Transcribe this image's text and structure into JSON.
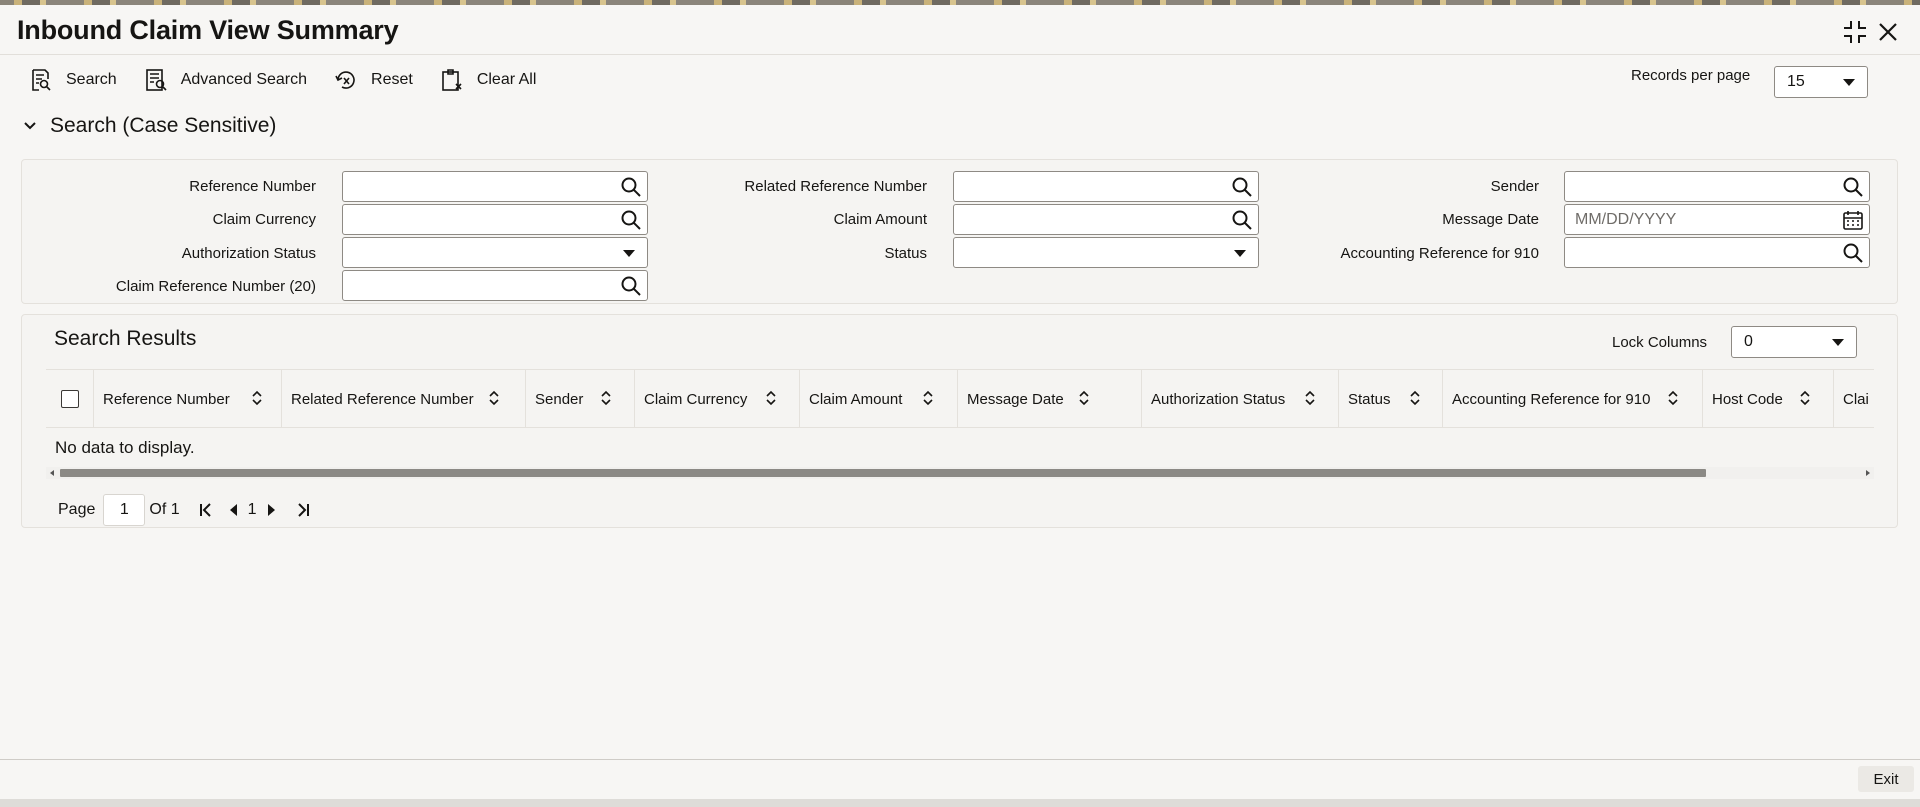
{
  "window": {
    "title": "Inbound Claim View Summary"
  },
  "toolbar": {
    "search_label": "Search",
    "advanced_search_label": "Advanced Search",
    "reset_label": "Reset",
    "clear_all_label": "Clear All",
    "records_per_page_label": "Records per page",
    "records_per_page_value": "15"
  },
  "search_section": {
    "title": "Search (Case Sensitive)",
    "fields": {
      "reference_number": "Reference Number",
      "related_reference_number": "Related Reference Number",
      "sender": "Sender",
      "claim_currency": "Claim Currency",
      "claim_amount": "Claim Amount",
      "message_date": "Message Date",
      "message_date_placeholder": "MM/DD/YYYY",
      "authorization_status": "Authorization Status",
      "status": "Status",
      "accounting_reference_910": "Accounting Reference for 910",
      "claim_reference_number_20": "Claim Reference Number (20)"
    }
  },
  "results": {
    "title": "Search Results",
    "lock_columns_label": "Lock Columns",
    "lock_columns_value": "0",
    "columns": [
      "Reference Number",
      "Related Reference Number",
      "Sender",
      "Claim Currency",
      "Claim Amount",
      "Message Date",
      "Authorization Status",
      "Status",
      "Accounting Reference for 910",
      "Host Code",
      "Clai"
    ],
    "empty_text": "No data to display."
  },
  "pagination": {
    "page_label": "Page",
    "page_value": "1",
    "of_label": "Of 1",
    "current": "1"
  },
  "footer": {
    "exit_label": "Exit"
  }
}
